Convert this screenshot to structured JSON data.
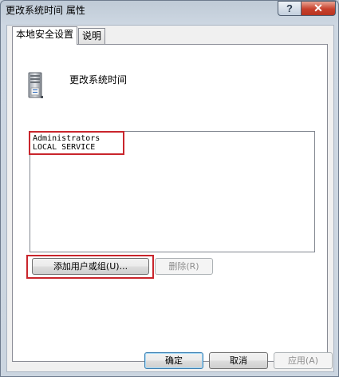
{
  "window": {
    "title": "更改系统时间 属性",
    "help_glyph": "?",
    "close_glyph": "✕"
  },
  "tabs": [
    {
      "label": "本地安全设置"
    },
    {
      "label": "说明"
    }
  ],
  "policy": {
    "icon": "server-icon",
    "name": "更改系统时间"
  },
  "accounts": [
    {
      "name": "Administrators"
    },
    {
      "name": "LOCAL SERVICE"
    }
  ],
  "buttons": {
    "add": "添加用户或组(U)...",
    "remove": "删除(R)",
    "ok": "确定",
    "cancel": "取消",
    "apply": "应用(A)"
  },
  "colors": {
    "highlight": "#c9252c"
  }
}
